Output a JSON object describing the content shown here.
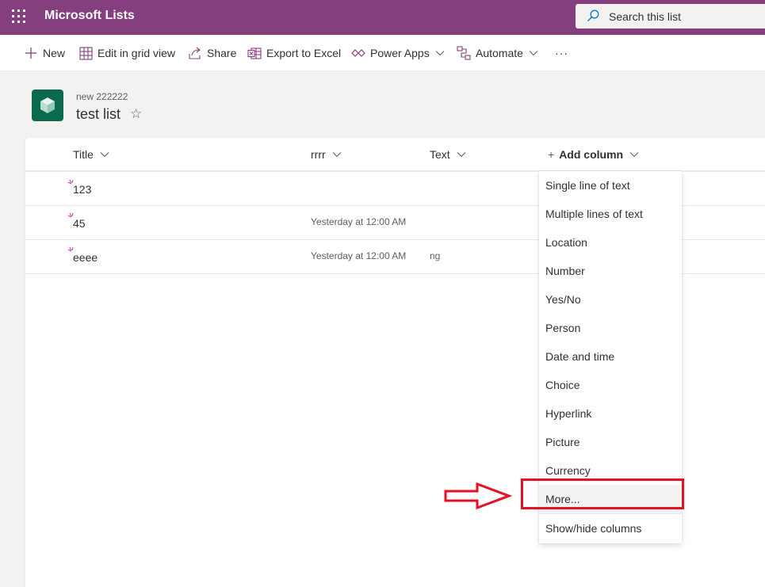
{
  "app": {
    "name": "Microsoft Lists"
  },
  "search": {
    "placeholder": "Search this list"
  },
  "commands": {
    "new": "New",
    "edit_grid": "Edit in grid view",
    "share": "Share",
    "export": "Export to Excel",
    "power_apps": "Power Apps",
    "automate": "Automate",
    "more": "···"
  },
  "list": {
    "breadcrumb": "new 222222",
    "title": "test list",
    "star": "☆"
  },
  "columns": {
    "title": "Title",
    "rrrr": "rrrr",
    "text": "Text",
    "add_plus": "+",
    "add": "Add column"
  },
  "rows": [
    {
      "title": "123",
      "rrrr": "",
      "text": ""
    },
    {
      "title": "45",
      "rrrr": "Yesterday at 12:00 AM",
      "text": ""
    },
    {
      "title": "eeee",
      "rrrr": "Yesterday at 12:00 AM",
      "text": "ng"
    }
  ],
  "menu": {
    "items": [
      "Single line of text",
      "Multiple lines of text",
      "Location",
      "Number",
      "Yes/No",
      "Person",
      "Date and time",
      "Choice",
      "Hyperlink",
      "Picture",
      "Currency",
      "More...",
      "Show/hide columns"
    ]
  },
  "colors": {
    "suite_bar": "#863f7e",
    "list_icon": "#0b6a4e",
    "accent_purple": "#863f7e",
    "annotation_red": "#e81123"
  },
  "icons": {
    "app_launcher": "waffle-icon",
    "search": "search-icon",
    "new": "plus-icon",
    "edit_grid": "grid-icon",
    "share": "share-icon",
    "export": "excel-icon",
    "power_apps": "power-apps-icon",
    "automate": "automate-icon",
    "favorite": "star-icon",
    "new_item": "sparkle-icon"
  }
}
